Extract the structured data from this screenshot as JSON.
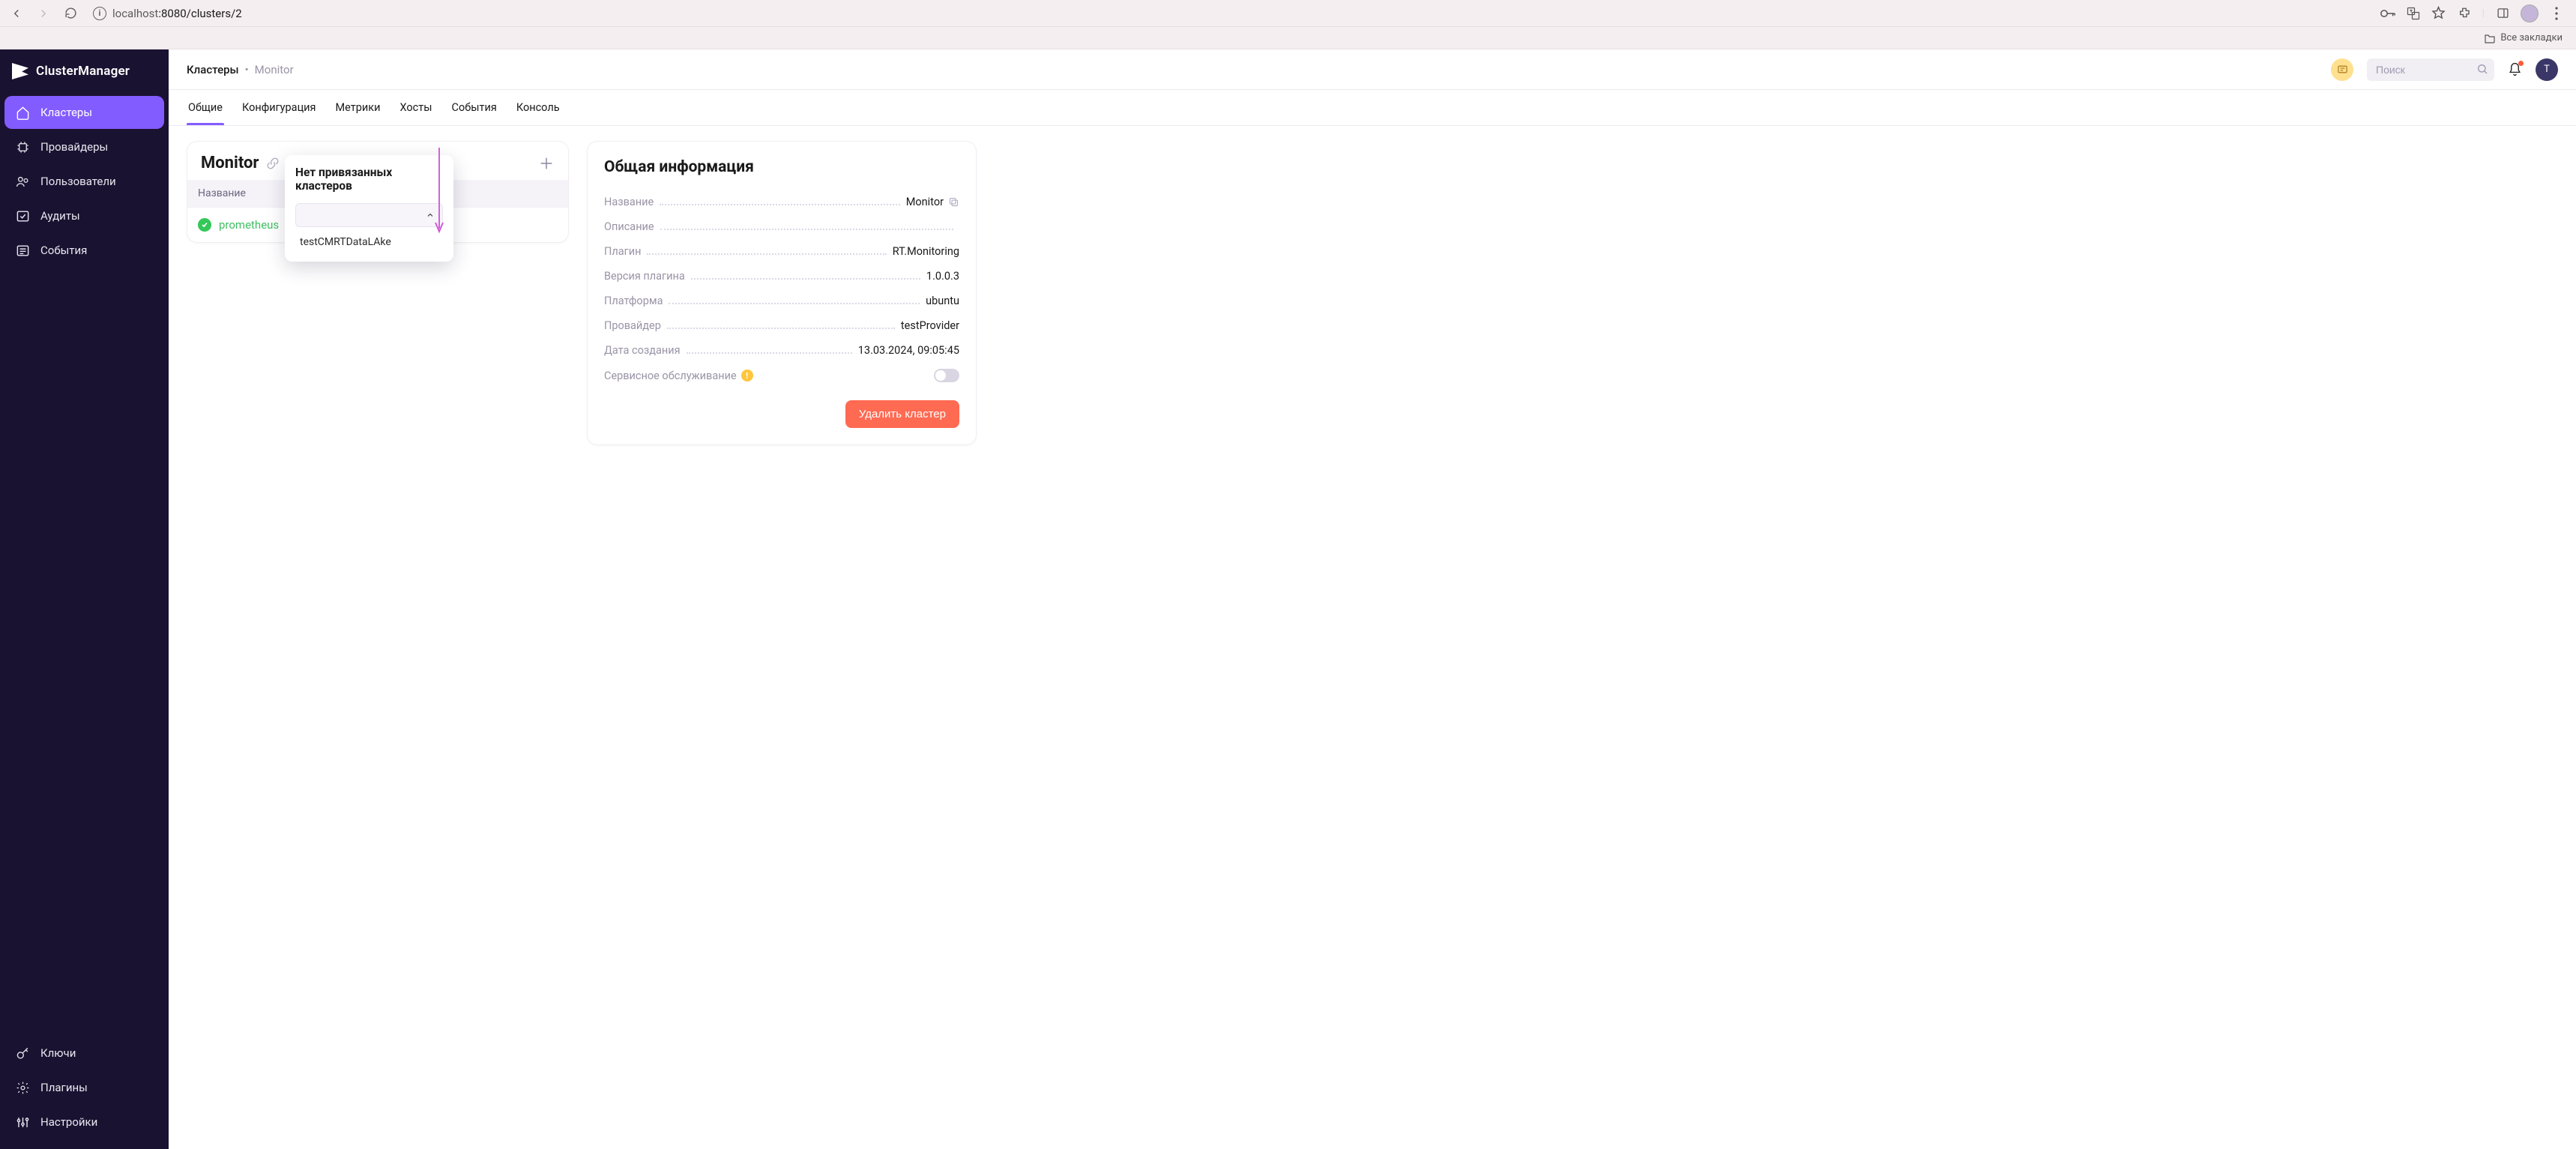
{
  "browser": {
    "url_host": "localhost",
    "url_port_path": ":8080/clusters/2",
    "bookmarks_label": "Все закладки"
  },
  "app": {
    "brand": "ClusterManager",
    "sidebar": {
      "top": [
        {
          "label": "Кластеры",
          "icon": "home-icon",
          "active": true
        },
        {
          "label": "Провайдеры",
          "icon": "chip-icon",
          "active": false
        },
        {
          "label": "Пользователи",
          "icon": "users-icon",
          "active": false
        },
        {
          "label": "Аудиты",
          "icon": "check-icon",
          "active": false
        },
        {
          "label": "События",
          "icon": "list-icon",
          "active": false
        }
      ],
      "bottom": [
        {
          "label": "Ключи",
          "icon": "key-icon"
        },
        {
          "label": "Плагины",
          "icon": "gear-icon"
        },
        {
          "label": "Настройки",
          "icon": "sliders-icon"
        }
      ]
    },
    "breadcrumb": {
      "root": "Кластеры",
      "current": "Monitor"
    },
    "search_placeholder": "Поиск",
    "user_initial": "T",
    "tabs": [
      "Общие",
      "Конфигурация",
      "Метрики",
      "Хосты",
      "События",
      "Консоль"
    ],
    "active_tab_index": 0,
    "cluster_card": {
      "title": "Monitor",
      "column_header": "Название",
      "rows": [
        {
          "name": "prometheus",
          "status": "ok"
        }
      ]
    },
    "popover": {
      "title": "Нет привязанных кластеров",
      "option": "testCMRTDataLAke"
    },
    "info_card": {
      "title": "Общая информация",
      "rows": [
        {
          "k": "Название",
          "v": "Monitor",
          "copy": true
        },
        {
          "k": "Описание",
          "v": ""
        },
        {
          "k": "Плагин",
          "v": "RT.Monitoring"
        },
        {
          "k": "Версия плагина",
          "v": "1.0.0.3"
        },
        {
          "k": "Платформа",
          "v": "ubuntu"
        },
        {
          "k": "Провайдер",
          "v": "testProvider"
        },
        {
          "k": "Дата создания",
          "v": "13.03.2024, 09:05:45"
        }
      ],
      "maintenance_label": "Сервисное обслуживание",
      "delete_label": "Удалить кластер"
    }
  }
}
